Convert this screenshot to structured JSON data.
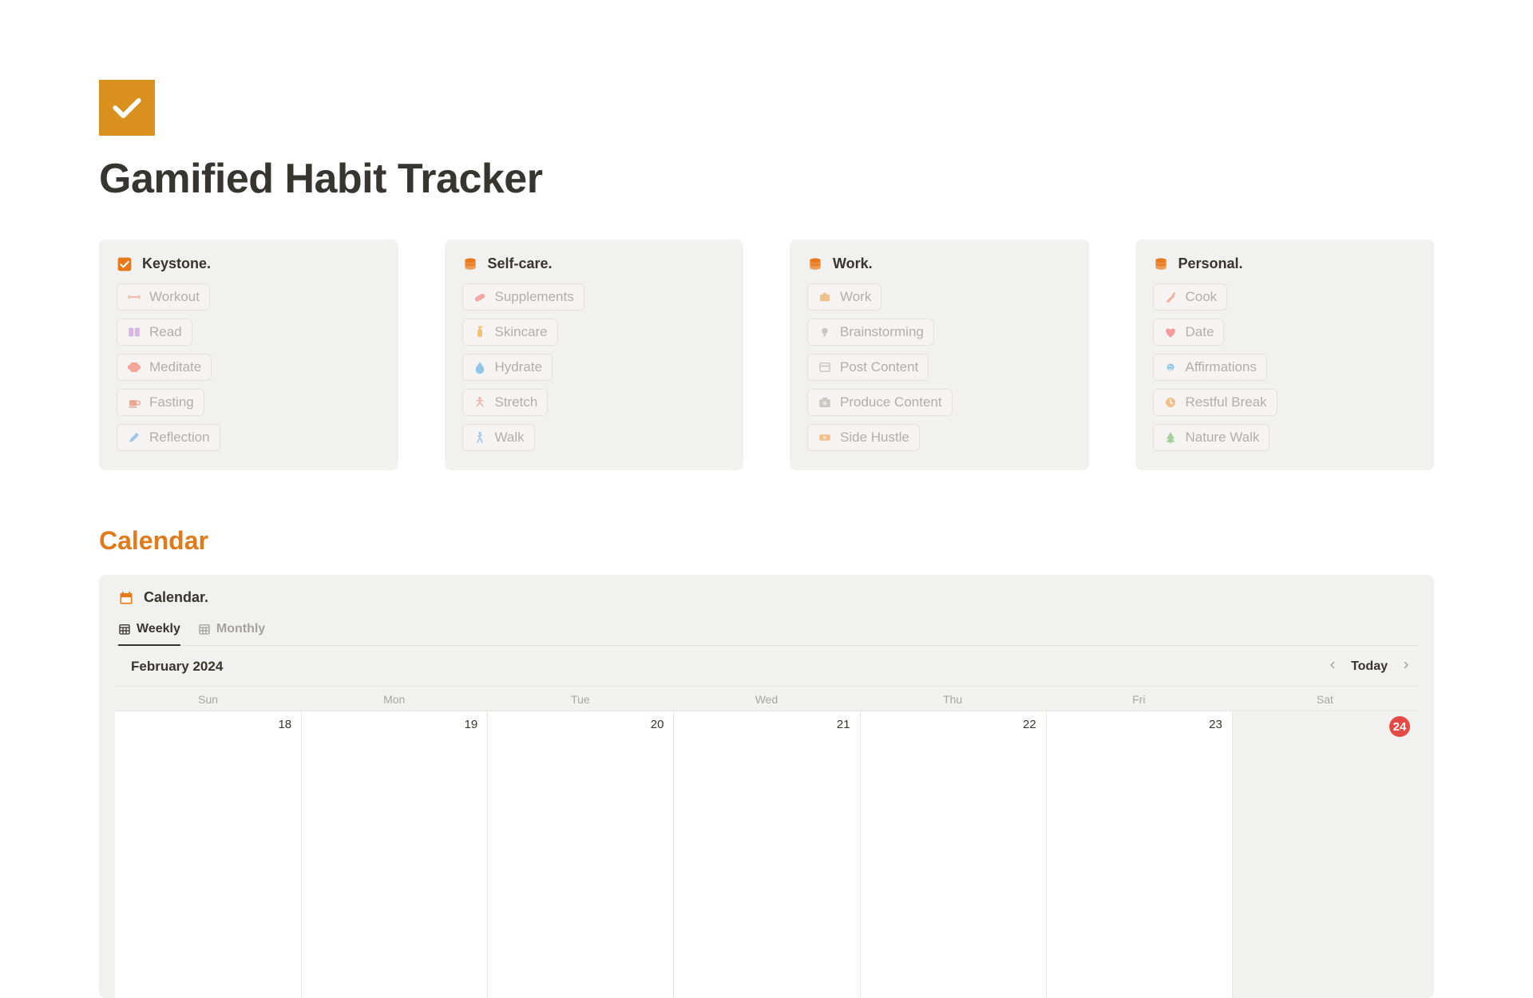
{
  "page": {
    "title": "Gamified Habit Tracker"
  },
  "cards": [
    {
      "icon": "checkbox",
      "title": "Keystone.",
      "items": [
        {
          "icon": "dumbbell",
          "color": "#f0b9a9",
          "label": "Workout"
        },
        {
          "icon": "book",
          "color": "#d7b6e0",
          "label": "Read"
        },
        {
          "icon": "brain",
          "color": "#f2a79a",
          "label": "Meditate"
        },
        {
          "icon": "mug",
          "color": "#e8a893",
          "label": "Fasting"
        },
        {
          "icon": "pencil",
          "color": "#9fc7ec",
          "label": "Reflection"
        }
      ]
    },
    {
      "icon": "stack",
      "title": "Self-care.",
      "items": [
        {
          "icon": "pill",
          "color": "#f2a7a0",
          "label": "Supplements"
        },
        {
          "icon": "lotion",
          "color": "#f1c27a",
          "label": "Skincare"
        },
        {
          "icon": "droplet",
          "color": "#8fc6ea",
          "label": "Hydrate"
        },
        {
          "icon": "stretch",
          "color": "#f1b0a0",
          "label": "Stretch"
        },
        {
          "icon": "walker",
          "color": "#9fc7ec",
          "label": "Walk"
        }
      ]
    },
    {
      "icon": "stack",
      "title": "Work.",
      "items": [
        {
          "icon": "briefcase",
          "color": "#f1c08a",
          "label": "Work"
        },
        {
          "icon": "bulb",
          "color": "#c9c7c2",
          "label": "Brainstorming"
        },
        {
          "icon": "window",
          "color": "#c9c7c2",
          "label": "Post Content"
        },
        {
          "icon": "camera",
          "color": "#c9c7c2",
          "label": "Produce Content"
        },
        {
          "icon": "cash",
          "color": "#f1c08a",
          "label": "Side Hustle"
        }
      ]
    },
    {
      "icon": "stack",
      "title": "Personal.",
      "items": [
        {
          "icon": "knife",
          "color": "#f1b0a0",
          "label": "Cook"
        },
        {
          "icon": "heart",
          "color": "#f49aa0",
          "label": "Date"
        },
        {
          "icon": "sparkle",
          "color": "#8fc6ea",
          "label": "Affirmations"
        },
        {
          "icon": "clock",
          "color": "#f1c08a",
          "label": "Restful Break"
        },
        {
          "icon": "tree",
          "color": "#a7cf9e",
          "label": "Nature Walk"
        }
      ]
    }
  ],
  "section": {
    "calendar_title": "Calendar"
  },
  "calendar": {
    "header": "Calendar.",
    "tabs": {
      "weekly": "Weekly",
      "monthly": "Monthly"
    },
    "month_label": "February 2024",
    "today_label": "Today",
    "dow": [
      "Sun",
      "Mon",
      "Tue",
      "Wed",
      "Thu",
      "Fri",
      "Sat"
    ],
    "days": [
      {
        "n": "18",
        "shaded": false,
        "today": false
      },
      {
        "n": "19",
        "shaded": false,
        "today": false
      },
      {
        "n": "20",
        "shaded": false,
        "today": false
      },
      {
        "n": "21",
        "shaded": false,
        "today": false
      },
      {
        "n": "22",
        "shaded": false,
        "today": false
      },
      {
        "n": "23",
        "shaded": false,
        "today": false
      },
      {
        "n": "24",
        "shaded": true,
        "today": true
      }
    ]
  }
}
